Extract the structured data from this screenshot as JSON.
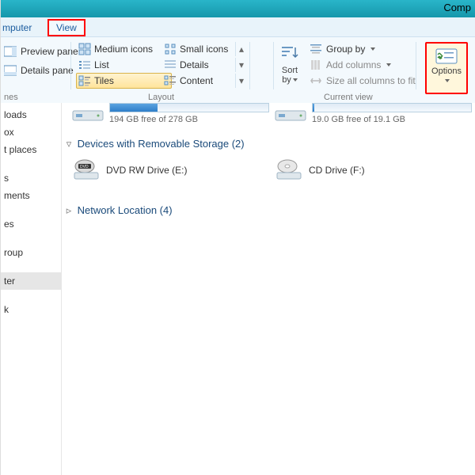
{
  "title": "Comp",
  "tabs": {
    "computer": "mputer",
    "view": "View"
  },
  "panes": {
    "preview": "Preview pane",
    "details": "Details pane",
    "label": "nes"
  },
  "layout": {
    "medium": "Medium icons",
    "small": "Small icons",
    "list": "List",
    "details": "Details",
    "tiles": "Tiles",
    "content": "Content",
    "label": "Layout"
  },
  "sort": {
    "line1": "Sort",
    "line2": "by"
  },
  "currentview": {
    "groupby": "Group by",
    "addcols": "Add columns",
    "size": "Size all columns to fit",
    "label": "Current view"
  },
  "options": "Options",
  "nav": {
    "loads": "loads",
    "ox": "ox",
    "places": "t places",
    "s": "s",
    "ments": "ments",
    "es": "es",
    "roup": "roup",
    "ter": "ter",
    "k": "k"
  },
  "drives": {
    "left_free": "194 GB free of 278 GB",
    "right_free": "19.0 GB free of 19.1 GB"
  },
  "cats": {
    "removable": "Devices with Removable Storage (2)",
    "network": "Network Location (4)"
  },
  "devs": {
    "dvd": "DVD RW Drive (E:)",
    "cd": "CD Drive (F:)"
  }
}
